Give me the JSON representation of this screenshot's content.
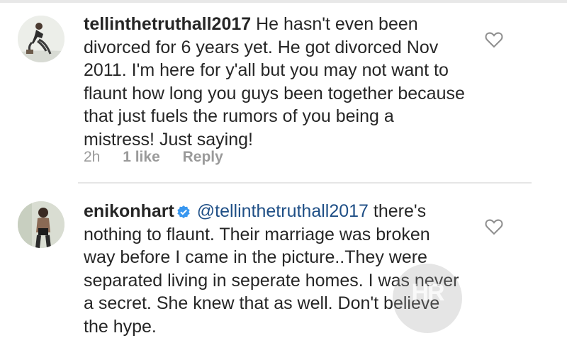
{
  "comments": [
    {
      "username": "tellinthetruthall2017",
      "text": " He hasn't even been divorced for 6 years yet. He got divorced Nov 2011. I'm here for y'all but you may not want to flaunt how long you guys been together because that just fuels the rumors of you being a mistress! Just saying!",
      "time": "2h",
      "likes": "1 like",
      "reply": "Reply",
      "avatar_icon": "user-avatar",
      "like_icon": "heart-outline-icon"
    },
    {
      "username": "enikonhart",
      "verified": true,
      "mention": "@tellinthetruthall2017",
      "text": " there's nothing to flaunt.  Their marriage was broken way before I came in the picture..They were separated living in seperate homes. I was never a secret. She knew that as well. Don't believe the hype.",
      "avatar_icon": "user-avatar",
      "like_icon": "heart-outline-icon"
    }
  ],
  "watermark": {
    "text": "HR"
  },
  "colors": {
    "text": "#262626",
    "meta": "#9a9a9a",
    "mention": "#1f4f86",
    "verified": "#3897f0",
    "divider": "#e6e6e6"
  }
}
